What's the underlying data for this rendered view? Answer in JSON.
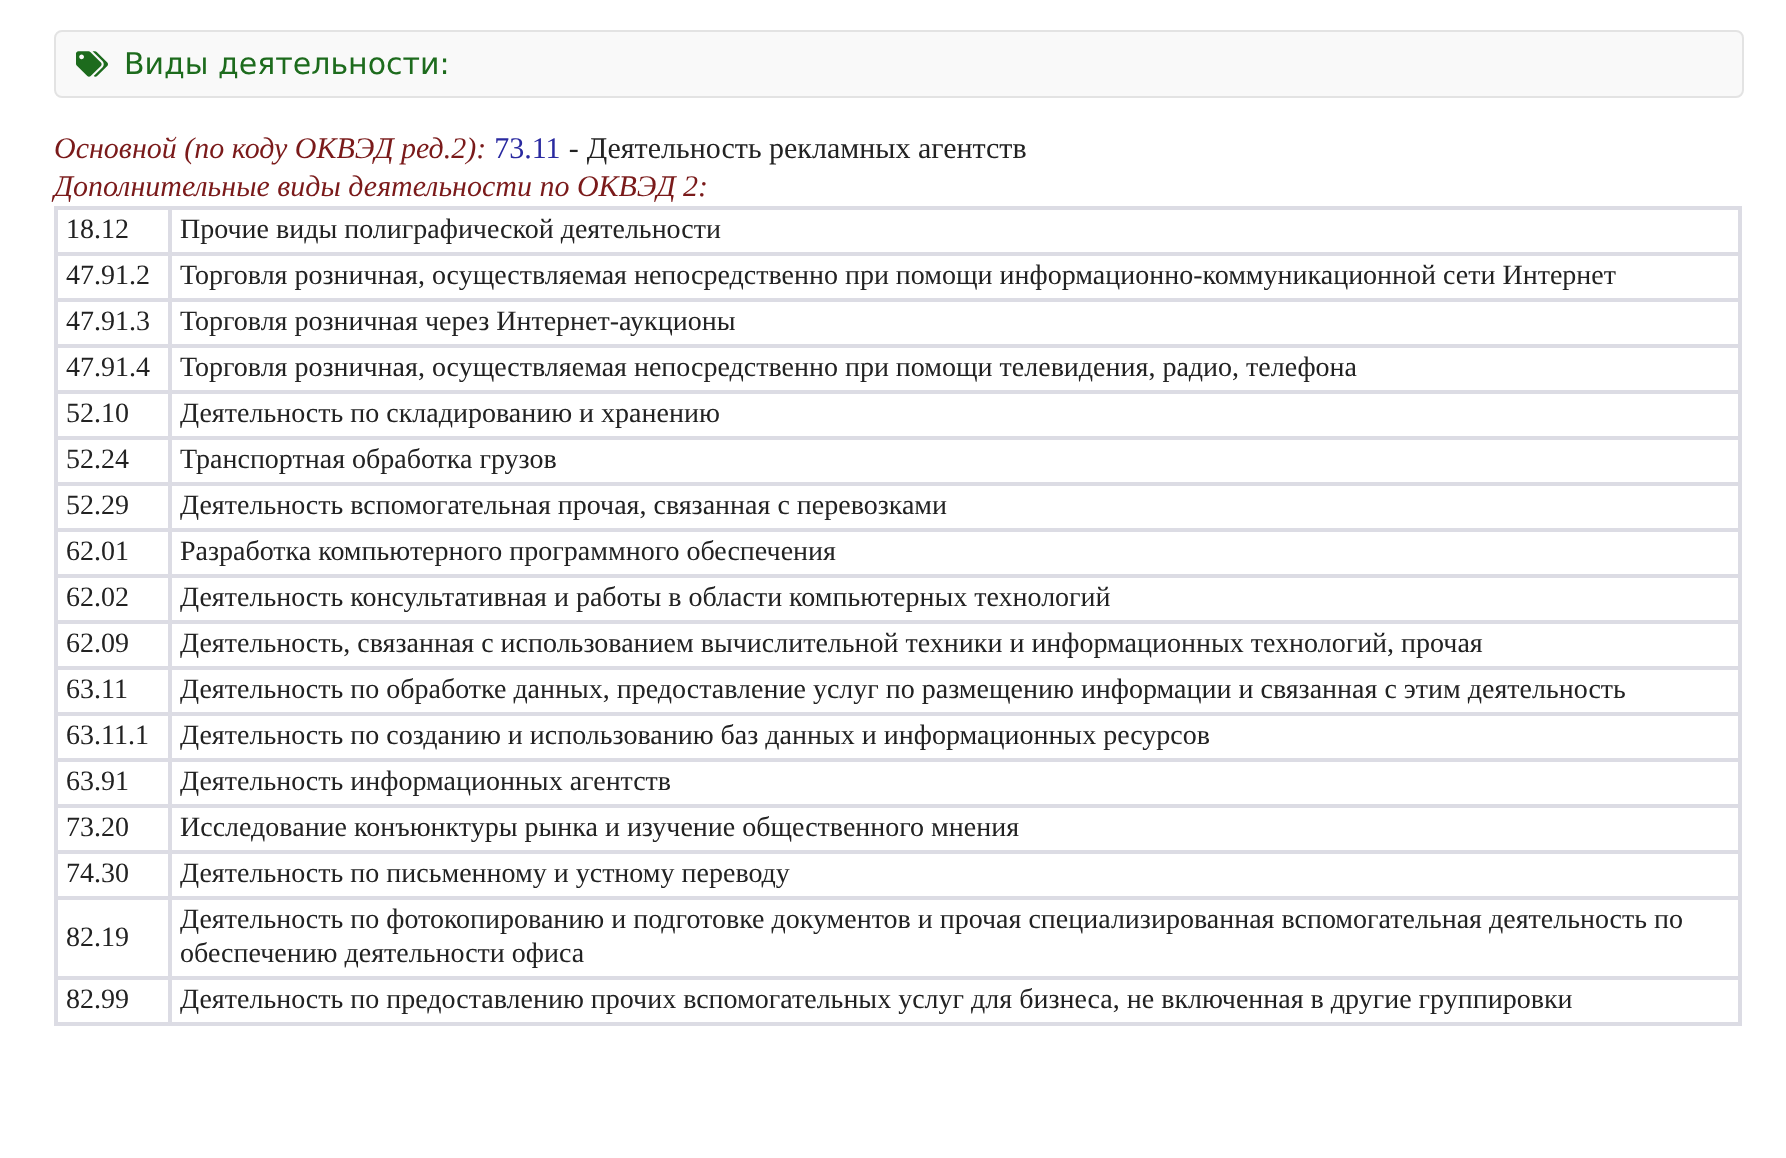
{
  "panel": {
    "title": "Виды деятельности:"
  },
  "main_activity": {
    "label": "Основной (по коду ОКВЭД ред.2):",
    "code": "73.11",
    "separator": "-",
    "name": "Деятельность рекламных агентств"
  },
  "additional_heading": "Дополнительные виды деятельности по ОКВЭД 2:",
  "table": {
    "rows": [
      {
        "code": "18.12",
        "name": "Прочие виды полиграфической деятельности"
      },
      {
        "code": "47.91.2",
        "name": "Торговля розничная, осуществляемая непосредственно при помощи информационно-коммуникационной сети Интернет"
      },
      {
        "code": "47.91.3",
        "name": "Торговля розничная через Интернет-аукционы"
      },
      {
        "code": "47.91.4",
        "name": "Торговля розничная, осуществляемая непосредственно при помощи телевидения, радио, телефона"
      },
      {
        "code": "52.10",
        "name": "Деятельность по складированию и хранению"
      },
      {
        "code": "52.24",
        "name": "Транспортная обработка грузов"
      },
      {
        "code": "52.29",
        "name": "Деятельность вспомогательная прочая, связанная с перевозками"
      },
      {
        "code": "62.01",
        "name": "Разработка компьютерного программного обеспечения"
      },
      {
        "code": "62.02",
        "name": "Деятельность консультативная и работы в области компьютерных технологий"
      },
      {
        "code": "62.09",
        "name": "Деятельность, связанная с использованием вычислительной техники и информационных технологий, прочая"
      },
      {
        "code": "63.11",
        "name": "Деятельность по обработке данных, предоставление услуг по размещению информации и связанная с этим деятельность"
      },
      {
        "code": "63.11.1",
        "name": "Деятельность по созданию и использованию баз данных и информационных ресурсов"
      },
      {
        "code": "63.91",
        "name": "Деятельность информационных агентств"
      },
      {
        "code": "73.20",
        "name": "Исследование конъюнктуры рынка и изучение общественного мнения"
      },
      {
        "code": "74.30",
        "name": "Деятельность по письменному и устному переводу"
      },
      {
        "code": "82.19",
        "name": "Деятельность по фотокопированию и подготовке документов и прочая специализированная вспомогательная деятельность по обеспечению деятельности офиса"
      },
      {
        "code": "82.99",
        "name": "Деятельность по предоставлению прочих вспомогательных услуг для бизнеса, не включенная в другие группировки"
      }
    ]
  }
}
